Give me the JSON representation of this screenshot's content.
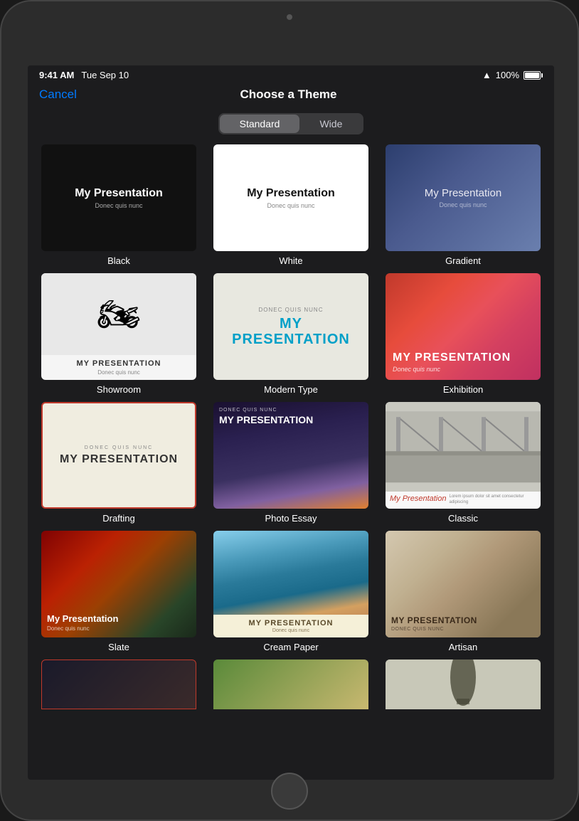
{
  "device": {
    "status_bar": {
      "time": "9:41 AM",
      "date": "Tue Sep 10",
      "wifi": "WiFi",
      "battery_pct": "100%"
    }
  },
  "header": {
    "cancel_label": "Cancel",
    "title": "Choose a Theme"
  },
  "segment": {
    "standard_label": "Standard",
    "wide_label": "Wide"
  },
  "themes": [
    {
      "id": "black",
      "label": "Black",
      "title": "My Presentation",
      "sub": "Donec quis nunc"
    },
    {
      "id": "white",
      "label": "White",
      "title": "My Presentation",
      "sub": "Donec quis nunc"
    },
    {
      "id": "gradient",
      "label": "Gradient",
      "title": "My Presentation",
      "sub": "Donec quis nunc"
    },
    {
      "id": "showroom",
      "label": "Showroom",
      "title": "MY PRESENTATION",
      "sub": "Donec quis nunc"
    },
    {
      "id": "modern-type",
      "label": "Modern Type",
      "title": "MY PRESENTATION",
      "small": "DONEC QUIS NUNC"
    },
    {
      "id": "exhibition",
      "label": "Exhibition",
      "title": "MY PRESENTATION",
      "sub": "Donec quis nunc"
    },
    {
      "id": "drafting",
      "label": "Drafting",
      "title": "MY PRESENTATION",
      "small": "DONEC QUIS NUNC"
    },
    {
      "id": "photo-essay",
      "label": "Photo Essay",
      "title": "MY PRESENTATION",
      "small": "DONEC QUIS NUNC"
    },
    {
      "id": "classic",
      "label": "Classic",
      "title": "My Presentation"
    },
    {
      "id": "slate",
      "label": "Slate",
      "title": "My Presentation",
      "sub": "Donec quis nunc"
    },
    {
      "id": "cream-paper",
      "label": "Cream Paper",
      "title": "MY PRESENTATION",
      "sub": "Donec quis nunc"
    },
    {
      "id": "artisan",
      "label": "Artisan",
      "title": "MY PRESENTATION",
      "sub": "DONEC QUIS NUNC"
    }
  ],
  "partial_themes": [
    {
      "id": "dark-gun",
      "label": ""
    },
    {
      "id": "food",
      "label": ""
    },
    {
      "id": "tree",
      "label": ""
    }
  ]
}
